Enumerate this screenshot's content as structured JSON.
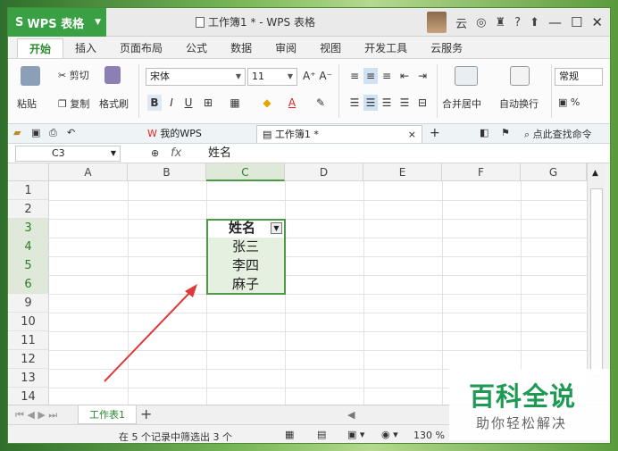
{
  "app": {
    "name": "WPS 表格"
  },
  "window": {
    "title": "工作簿1 * - WPS 表格",
    "user_label": "云",
    "help": "?"
  },
  "ribbon_tabs": [
    "开始",
    "插入",
    "页面布局",
    "公式",
    "数据",
    "审阅",
    "视图",
    "开发工具",
    "云服务"
  ],
  "ribbon": {
    "paste": "粘贴",
    "cut": "剪切",
    "copy": "复制",
    "format_painter": "格式刷",
    "font_name": "宋体",
    "font_size": "11",
    "merge_center": "合并居中",
    "wrap_text": "自动换行",
    "number_format": "常规",
    "percent": "%"
  },
  "doc_tabs": {
    "my_wps": "我的WPS",
    "workbook": "工作簿1 *",
    "search": "点此查找命令"
  },
  "formula_bar": {
    "cell_ref": "C3",
    "fx": "fx",
    "content": "姓名"
  },
  "grid": {
    "columns": [
      "A",
      "B",
      "C",
      "D",
      "E",
      "F",
      "G"
    ],
    "rows": [
      "1",
      "2",
      "3",
      "4",
      "5",
      "6",
      "9",
      "10",
      "11",
      "12",
      "13",
      "14"
    ],
    "cells": {
      "header": "姓名",
      "r4": "张三",
      "r5": "李四",
      "r6": "麻子"
    }
  },
  "sheets": {
    "active": "工作表1",
    "add": "+"
  },
  "status": {
    "filter_text": "在 5 个记录中筛选出 3 个",
    "zoom": "130 %"
  },
  "watermark": {
    "title": "百科全说",
    "subtitle": "助你轻松解决"
  },
  "colors": {
    "accent": "#39a044",
    "selection": "#4d9a46",
    "arrow": "#e0393b"
  }
}
